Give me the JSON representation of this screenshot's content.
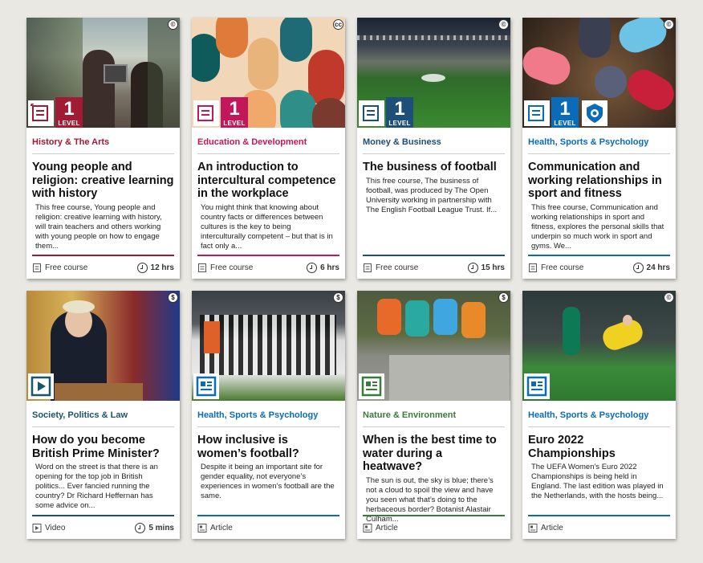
{
  "colors": {
    "history": "#a01b33",
    "education": "#c2185b",
    "business": "#1d4f78",
    "health": "#0a6cb8",
    "society": "#19556b",
    "nature": "#3a7a3d"
  },
  "cards": [
    {
      "category": "History & The Arts",
      "title": "Young people and religion: creative learning with history",
      "desc": "This free course, Young people and religion: creative learning with history, will train teachers and others working with young people on how to engage them...",
      "type_label": "Free course",
      "duration": "12 hrs",
      "level_num": "1",
      "level_label": "LEVEL",
      "license_icon": "cc-icon"
    },
    {
      "category": "Education & Development",
      "title": "An introduction to intercultural competence in the workplace",
      "desc": "You might think that knowing about country facts or differences between cultures is the key to being interculturally competent – but that is in fact only a...",
      "type_label": "Free course",
      "duration": "6 hrs",
      "level_num": "1",
      "level_label": "LEVEL",
      "license_icon": "cc-by-nc-icon"
    },
    {
      "category": "Money & Business",
      "title": "The business of football",
      "desc": "This free course, The business of football, was produced by The Open University working in partnership with The English Football League Trust. If...",
      "type_label": "Free course",
      "duration": "15 hrs",
      "level_num": "1",
      "level_label": "LEVEL",
      "license_icon": "copyright-icon"
    },
    {
      "category": "Health, Sports & Psychology",
      "title": "Communication and working relationships in sport and fitness",
      "desc": "This free course, Communication and working relationships in sport and fitness, explores the personal skills that underpin so much work in sport and gyms. We...",
      "type_label": "Free course",
      "duration": "24 hrs",
      "level_num": "1",
      "level_label": "LEVEL",
      "license_icon": "copyright-icon"
    },
    {
      "category": "Society, Politics & Law",
      "title": "How do you become British Prime Minister?",
      "desc": "Word on the street is that there is an opening for the top job in British politics... Ever fancied running the country? Dr Richard Heffernan has some advice on...",
      "type_label": "Video",
      "duration": "5 mins",
      "license_icon": "cc-nc-icon"
    },
    {
      "category": "Health, Sports & Psychology",
      "title": "How inclusive is women’s football?",
      "desc": "Despite it being an important site for gender equality, not everyone’s experiences in women’s football are the same.",
      "type_label": "Article",
      "duration": "",
      "license_icon": "cc-nc-icon"
    },
    {
      "category": "Nature & Environment",
      "title": "When is the best time to water during a heatwave?",
      "desc": "The sun is out, the sky is blue; there’s not a cloud to spoil the view and have you seen what that’s doing to the herbaceous border? Botanist Alastair Culham...",
      "type_label": "Article",
      "duration": "",
      "license_icon": "cc-nc-icon"
    },
    {
      "category": "Health, Sports & Psychology",
      "title": "Euro 2022 Championships",
      "desc": "The UEFA Women's Euro 2022 Championships is being held in England. The last edition was played in the Netherlands, with the hosts being...",
      "type_label": "Article",
      "duration": "",
      "license_icon": "copyright-icon"
    }
  ]
}
